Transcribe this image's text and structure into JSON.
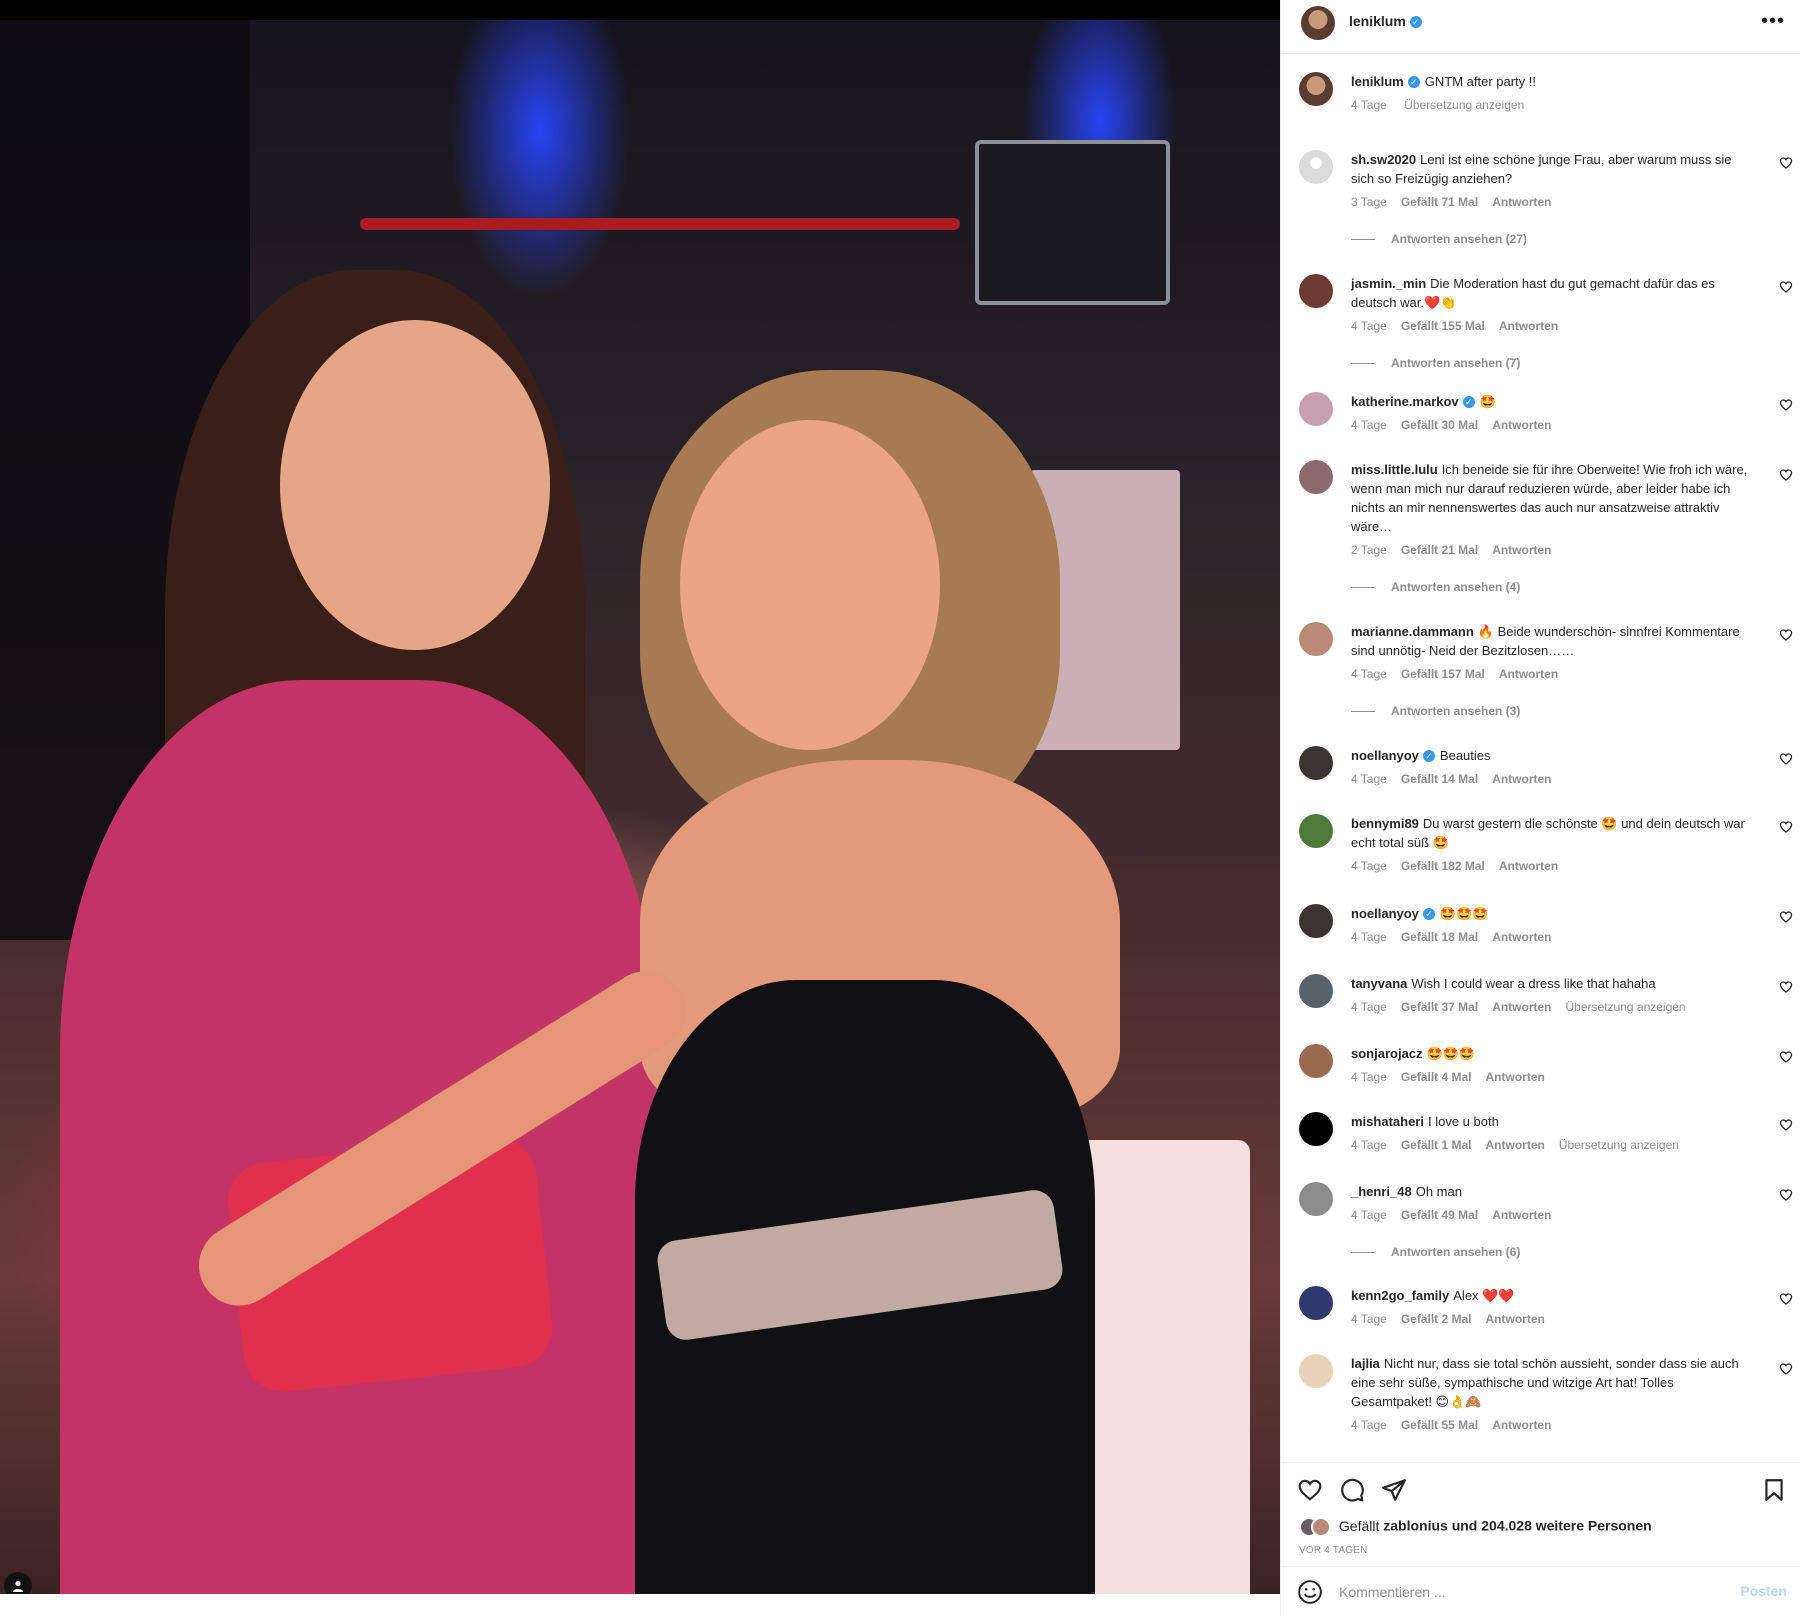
{
  "post": {
    "username": "leniklum",
    "caption": "GNTM after party !!",
    "caption_time": "4 Tage",
    "translate_label": "Übersetzung anzeigen"
  },
  "comments": [
    {
      "user": "sh.sw2020",
      "verified": false,
      "text": "Leni ist eine schöne junge Frau, aber warum muss sie sich so Freizügig anziehen?",
      "time": "3 Tage",
      "likes": "Gefällt 71 Mal",
      "reply": "Antworten",
      "translate": "",
      "view_replies": "Antworten ansehen (27)",
      "avatar_color": "#dbdbdb"
    },
    {
      "user": "jasmin._min",
      "verified": false,
      "text": "Die Moderation hast du gut gemacht dafür das es deutsch war.❤️👏",
      "time": "4 Tage",
      "likes": "Gefällt 155 Mal",
      "reply": "Antworten",
      "translate": "",
      "view_replies": "Antworten ansehen (7)",
      "avatar_color": "#6b3b34"
    },
    {
      "user": "katherine.markov",
      "verified": true,
      "text": "🤩",
      "time": "4 Tage",
      "likes": "Gefällt 30 Mal",
      "reply": "Antworten",
      "translate": "",
      "view_replies": "",
      "avatar_color": "#c7a0b0"
    },
    {
      "user": "miss.little.lulu",
      "verified": false,
      "text": "Ich beneide sie für ihre Oberweite! Wie froh ich wäre, wenn man mich nur darauf reduzieren würde, aber leider habe ich nichts an mir nennenswertes das auch nur ansatzweise attraktiv wäre…",
      "time": "2 Tage",
      "likes": "Gefällt 21 Mal",
      "reply": "Antworten",
      "translate": "",
      "view_replies": "Antworten ansehen (4)",
      "avatar_color": "#8a6a6a"
    },
    {
      "user": "marianne.dammann",
      "verified": false,
      "text": "🔥 Beide wunderschön- sinnfrei Kommentare sind unnötig- Neid der Bezitzlosen……",
      "time": "4 Tage",
      "likes": "Gefällt 157 Mal",
      "reply": "Antworten",
      "translate": "",
      "view_replies": "Antworten ansehen (3)",
      "avatar_color": "#b98a78"
    },
    {
      "user": "noellanyoy",
      "verified": true,
      "text": "Beauties",
      "time": "4 Tage",
      "likes": "Gefällt 14 Mal",
      "reply": "Antworten",
      "translate": "",
      "view_replies": "",
      "avatar_color": "#3b3432"
    },
    {
      "user": "bennymi89",
      "verified": false,
      "text": "Du warst gestern die schönste 🤩 und dein deutsch war echt total süß 🤩",
      "time": "4 Tage",
      "likes": "Gefällt 182 Mal",
      "reply": "Antworten",
      "translate": "",
      "view_replies": "",
      "avatar_color": "#4f7a3c"
    },
    {
      "user": "noellanyoy",
      "verified": true,
      "text": "🤩🤩🤩",
      "time": "4 Tage",
      "likes": "Gefällt 18 Mal",
      "reply": "Antworten",
      "translate": "",
      "view_replies": "",
      "avatar_color": "#3b3432"
    },
    {
      "user": "tanyvana",
      "verified": false,
      "text": "Wish I could wear a dress like that hahaha",
      "time": "4 Tage",
      "likes": "Gefällt 37 Mal",
      "reply": "Antworten",
      "translate": "Übersetzung anzeigen",
      "view_replies": "",
      "avatar_color": "#58626b"
    },
    {
      "user": "sonjarojacz",
      "verified": false,
      "text": "🤩🤩🤩",
      "time": "4 Tage",
      "likes": "Gefällt 4 Mal",
      "reply": "Antworten",
      "translate": "",
      "view_replies": "",
      "avatar_color": "#9a6b4e"
    },
    {
      "user": "mishataheri",
      "verified": false,
      "text": "I love u both",
      "time": "4 Tage",
      "likes": "Gefällt 1 Mal",
      "reply": "Antworten",
      "translate": "Übersetzung anzeigen",
      "view_replies": "",
      "avatar_color": "#000000"
    },
    {
      "user": "_henri_48",
      "verified": false,
      "text": "Oh man",
      "time": "4 Tage",
      "likes": "Gefällt 49 Mal",
      "reply": "Antworten",
      "translate": "",
      "view_replies": "Antworten ansehen (6)",
      "avatar_color": "#8c8c8c"
    },
    {
      "user": "kenn2go_family",
      "verified": false,
      "text": "Alex ❤️❤️",
      "time": "4 Tage",
      "likes": "Gefällt 2 Mal",
      "reply": "Antworten",
      "translate": "",
      "view_replies": "",
      "avatar_color": "#2d3a6b"
    },
    {
      "user": "lajlia",
      "verified": false,
      "text": "Nicht nur, dass sie total schön aussieht, sonder dass sie auch eine sehr süße, sympathische und witzige Art hat! Tolles Gesamtpaket! 😊👌🙈",
      "time": "4 Tage",
      "likes": "Gefällt 55 Mal",
      "reply": "Antworten",
      "translate": "",
      "view_replies": "",
      "avatar_color": "#e8d2b8"
    }
  ],
  "actions": {
    "liked_by_prefix": "Gefällt",
    "liked_by_user": "zablonius",
    "liked_by_rest": "und 204.028 weitere Personen",
    "posted_ago": "VOR 4 TAGEN"
  },
  "composer": {
    "placeholder": "Kommentieren ...",
    "post_label": "Posten"
  },
  "colors": {
    "verified": "#3897f0",
    "heart_red": "#ed4956",
    "post_button_disabled": "#b3dbff",
    "secondary_text": "#8e8e8e"
  }
}
